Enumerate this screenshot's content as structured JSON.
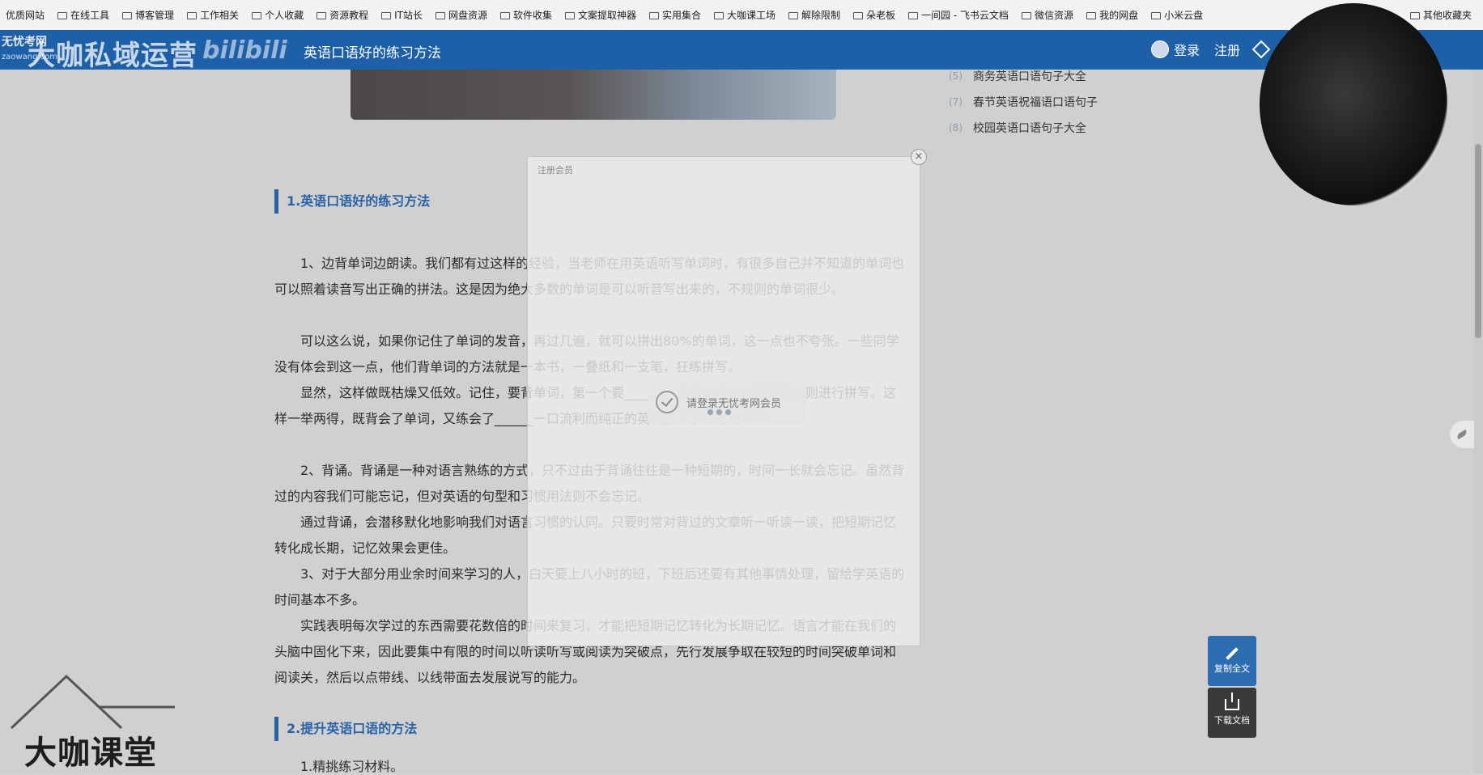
{
  "bookmarks": [
    "优质网站",
    "在线工具",
    "博客管理",
    "工作相关",
    "个人收藏",
    "资源教程",
    "IT站长",
    "网盘资源",
    "软件收集",
    "文案提取神器",
    "实用集合",
    "大咖课工场",
    "解除限制",
    "朵老板",
    "一间园 - 飞书云文档",
    "微信资源",
    "我的网盘",
    "小米云盘"
  ],
  "bookmarks_other": "其他收藏夹",
  "header": {
    "logo": "无忧考网",
    "logo_sub": "zaowang.com",
    "watermark": "大咖私域运营",
    "watermark2": "bilibili",
    "breadcrumb": "英语口语好的练习方法",
    "login": "登录",
    "register": "注册"
  },
  "related": [
    {
      "num": "(5)",
      "label": "商务英语口语句子大全"
    },
    {
      "num": "(7)",
      "label": "春节英语祝福语口语句子"
    },
    {
      "num": "(8)",
      "label": "校园英语口语句子大全"
    }
  ],
  "article": {
    "h1": "1.英语口语好的练习方法",
    "p1": "1、边背单词边朗读。我们都有过这样的经验，当老师在用英语听写单词时，有很多自己并不知道的单词也可以照着读音写出正确的拼法。这是因为绝大多数的单词是可以听音写出来的，不规则的单词很少。",
    "p2": "可以这么说，如果你记住了单词的发音，再过几遍，就可以拼出80%的单词，这一点也不夸张。一些同学没有体会到这一点，他们背单词的方法就是一本书，一叠纸和一支笔，狂练拼写。",
    "p3": "显然，这样做既枯燥又低效。记住，要背单词，第一个要______，然后你可以按照读音规则进行拼写。这样一举两得，既背会了单词，又练会了______一口流利而纯正的英语打下了良好的基础。",
    "p4": "2、背诵。背诵是一种对语言熟练的方式，只不过由于背诵往往是一种短期的，时间一长就会忘记。虽然背过的内容我们可能忘记，但对英语的句型和习惯用法则不会忘记。",
    "p5": "通过背诵，会潜移默化地影响我们对语言习惯的认同。只要时常对背过的文章听一听读一读，把短期记忆转化成长期，记忆效果会更佳。",
    "p6": "3、对于大部分用业余时间来学习的人，白天要上八小时的班，下班后还要有其他事情处理，留给学英语的时间基本不多。",
    "p7": "实践表明每次学过的东西需要花数倍的时间来复习，才能把短期记忆转化为长期记忆。语言才能在我们的头脑中固化下来，因此要集中有限的时间以听读听写或阅读为突破点，先行发展争取在较短的时间突破单词和阅读关，然后以点带线、以线带面去发展说写的能力。",
    "h2": "2.提升英语口语的方法",
    "sub1": "1.精挑练习材料。"
  },
  "modal": {
    "title": "注册会员",
    "loading": "请登录无忧考网会员",
    "close": "×"
  },
  "buttons": {
    "copy": "复制全文",
    "download": "下载文档"
  },
  "watermark_bottom": "大咖课堂"
}
